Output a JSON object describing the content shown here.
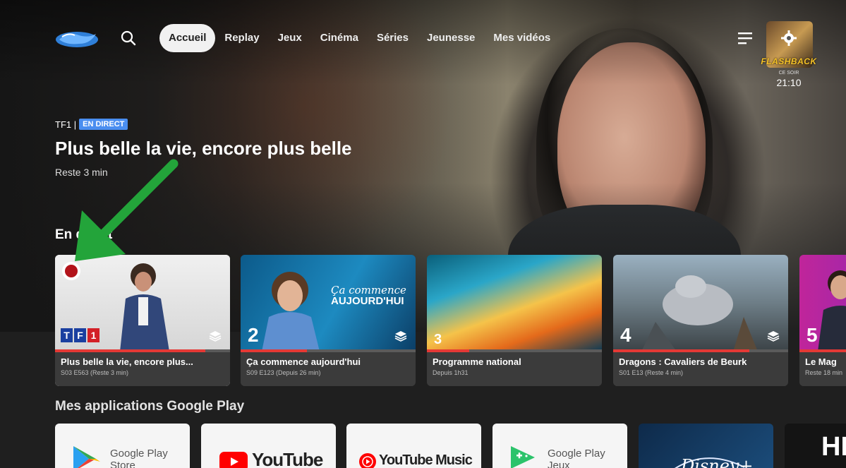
{
  "topbar": {
    "logo": "6ter-logo",
    "nav": [
      "Accueil",
      "Replay",
      "Jeux",
      "Cinéma",
      "Séries",
      "Jeunesse",
      "Mes vidéos"
    ],
    "active_index": 0,
    "promo": {
      "title": "FLASHBACK",
      "subtitle": "CE SOIR",
      "time": "21:10"
    }
  },
  "hero": {
    "channel": "TF1 |",
    "badge": "EN DIRECT",
    "title": "Plus belle la vie, encore plus belle",
    "remaining": "Reste 3 min"
  },
  "live_section": {
    "title": "En direct",
    "cards": [
      {
        "title": "Plus belle la vie, encore plus...",
        "subtitle": "S03 E563 (Reste 3 min)",
        "channel": "TF1",
        "progress": 0.86,
        "recording": true
      },
      {
        "title": "Ça commence aujourd'hui",
        "subtitle": "S09 E123 (Depuis 26 min)",
        "channel": "2",
        "progress": 0.38,
        "overlay": "Ça commence AUJOURD'HUI"
      },
      {
        "title": "Programme national",
        "subtitle": "Depuis 1h31",
        "channel": "3",
        "progress": 0.24
      },
      {
        "title": "Dragons : Cavaliers de Beurk",
        "subtitle": "S01 E13 (Reste 4 min)",
        "channel": "4",
        "progress": 0.78
      },
      {
        "title": "Le Mag",
        "subtitle": "Reste 18 min",
        "channel": "5",
        "progress": 0.5
      }
    ]
  },
  "apps_section": {
    "title": "Mes applications Google Play",
    "apps": [
      "Google Play Store",
      "YouTube",
      "YouTube Music",
      "Google Play Jeux",
      "Disney+",
      "HBO"
    ]
  },
  "colors": {
    "accent_live": "#4a8ef0",
    "progress": "#e53935",
    "arrow": "#23a43a"
  }
}
